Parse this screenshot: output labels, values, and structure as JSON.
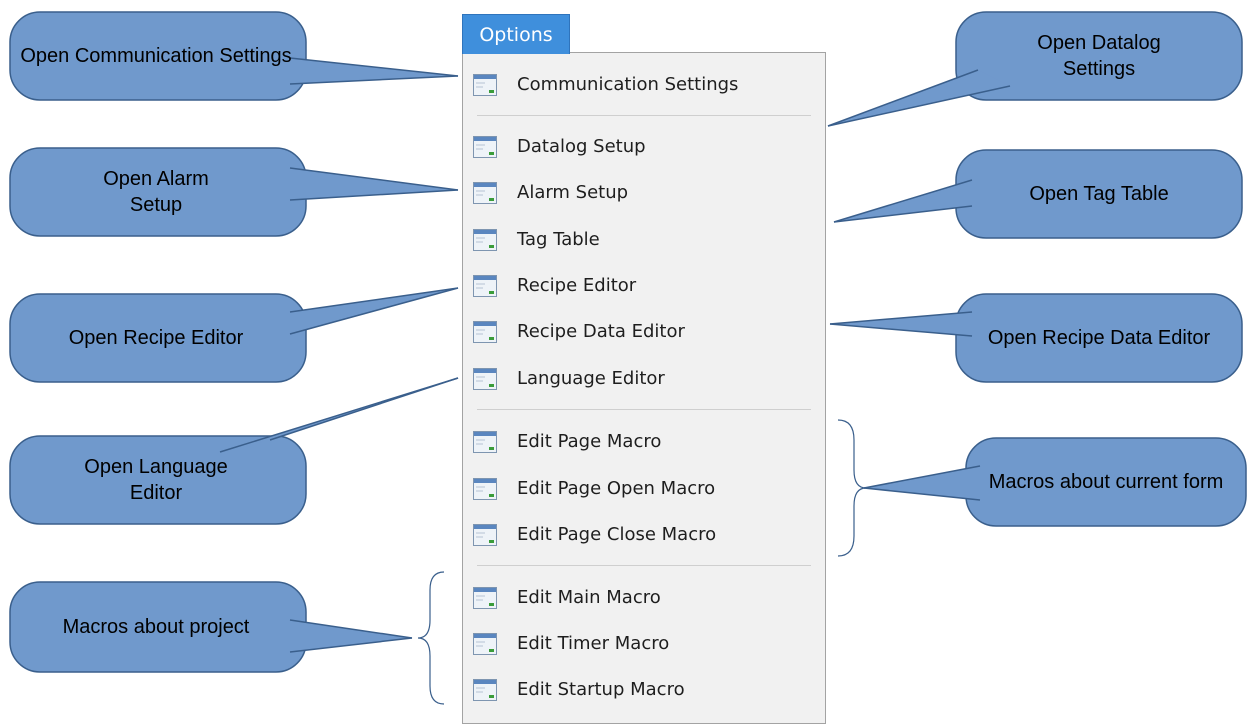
{
  "menu": {
    "title": "Options",
    "items": [
      {
        "label": "Communication Settings",
        "icon": "window-icon"
      },
      {
        "label": "Datalog Setup",
        "icon": "window-icon"
      },
      {
        "label": "Alarm Setup",
        "icon": "window-icon"
      },
      {
        "label": "Tag Table",
        "icon": "window-icon"
      },
      {
        "label": "Recipe Editor",
        "icon": "window-icon"
      },
      {
        "label": "Recipe Data Editor",
        "icon": "window-icon"
      },
      {
        "label": "Language Editor",
        "icon": "window-icon"
      },
      {
        "label": "Edit Page Macro",
        "icon": "window-icon"
      },
      {
        "label": "Edit Page Open Macro",
        "icon": "window-icon"
      },
      {
        "label": "Edit Page Close Macro",
        "icon": "window-icon"
      },
      {
        "label": "Edit Main Macro",
        "icon": "window-icon"
      },
      {
        "label": "Edit Timer Macro",
        "icon": "window-icon"
      },
      {
        "label": "Edit Startup Macro",
        "icon": "window-icon"
      }
    ]
  },
  "callouts": {
    "communication": "Open Communication Settings",
    "datalog": "Open Datalog Settings",
    "alarm": "Open Alarm Setup",
    "tag_table": "Open Tag Table",
    "recipe_editor": "Open Recipe Editor",
    "recipe_data": "Open Recipe Data Editor",
    "language": "Open Language Editor",
    "macros_form": "Macros about current form",
    "macros_project": "Macros about project"
  },
  "colors": {
    "callout_fill": "#7099cc",
    "callout_stroke": "#3a5f8c",
    "menu_title_bg": "#3f8fdc"
  }
}
